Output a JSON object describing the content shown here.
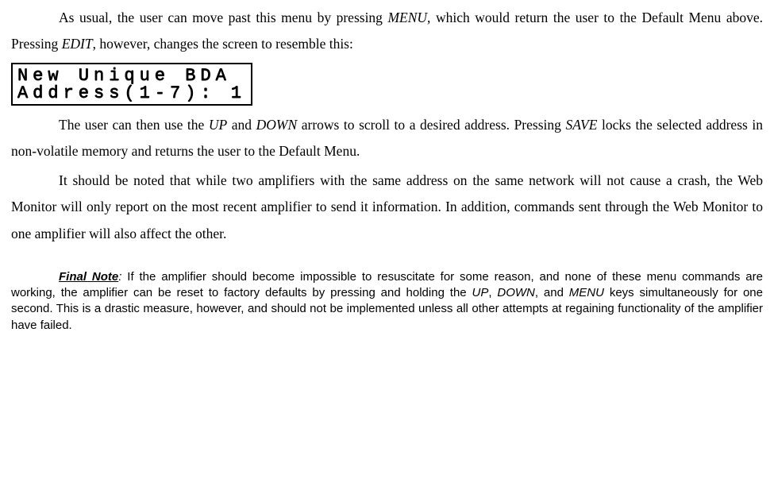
{
  "p1": {
    "a": "As usual, the user can move past this menu by pressing ",
    "menu": "MENU",
    "b": ", which would return the user to the Default Menu above.  Pressing ",
    "edit": "EDIT",
    "c": ", however, changes the screen to resemble this:"
  },
  "lcd": {
    "line1": "New Unique BDA",
    "line2": "Address(1-7): 1"
  },
  "p2": {
    "a": "The user can then use the ",
    "up": "UP",
    "b": " and ",
    "down": "DOWN",
    "c": " arrows to scroll to a desired address.  Pressing ",
    "save": "SAVE",
    "d": " locks the selected address in non-volatile memory and returns the user to the Default Menu."
  },
  "p3": "It should be noted that while two amplifiers with the same address on the same network will not cause a crash, the Web Monitor will only report on the most recent amplifier to send it information.  In addition, commands sent through the Web Monitor to one amplifier will also affect the other.",
  "final": {
    "label": "Final Note",
    "colon": ":",
    "a": "  If the amplifier should become impossible to resuscitate for some reason, and none of these menu commands are working, the amplifier can be reset to factory defaults by pressing and holding the ",
    "up": "UP",
    "b": ", ",
    "down": "DOWN",
    "c": ", and ",
    "menu": "MENU",
    "d": " keys simultaneously for one second.  This is a drastic measure, however, and should not be implemented unless all other attempts at regaining functionality of the amplifier have failed."
  }
}
